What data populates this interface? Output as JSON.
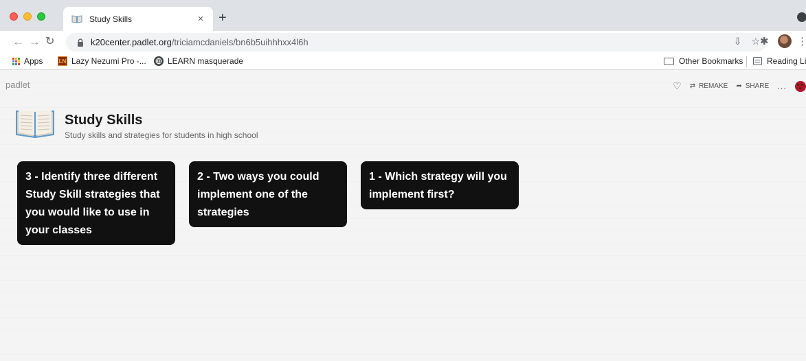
{
  "browser": {
    "tab_title": "Study Skills",
    "tab_close": "×",
    "new_tab": "+",
    "url_host": "k20center.padlet.org",
    "url_path": "/triciamcdaniels/bn6b5uihhhxx4l6h",
    "bookmarks": {
      "apps": "Apps",
      "lazy_badge": "LN",
      "lazy": "Lazy Nezumi Pro -...",
      "learn": "LEARN masquerade",
      "other": "Other Bookmarks",
      "reading": "Reading Lis"
    }
  },
  "padlet": {
    "logo": "padlet",
    "actions": {
      "remake": "REMAKE",
      "share": "SHARE",
      "more": "..."
    },
    "title": "Study Skills",
    "description": "Study skills and strategies for students in high school",
    "columns": [
      {
        "heading": "3 - Identify three different Study Skill strategies that you would like to use in your classes"
      },
      {
        "heading": "2 - Two ways you could implement one of the strategies"
      },
      {
        "heading": "1 - Which strategy will you implement first?"
      }
    ]
  },
  "colors": {
    "card_bg": "#111111",
    "card_text": "#ffffff",
    "page_bg": "#f4f4f4"
  }
}
